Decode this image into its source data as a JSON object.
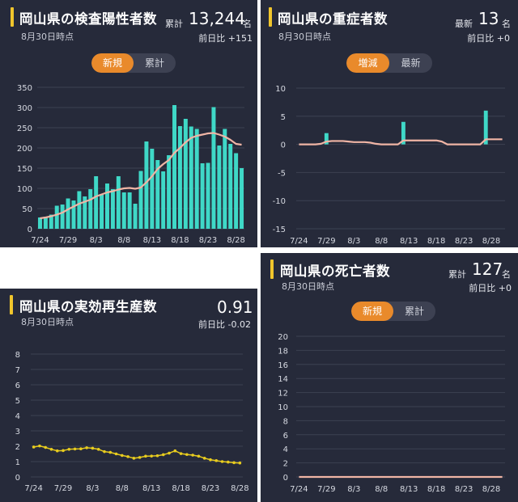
{
  "panels": {
    "positive": {
      "title": "岡山県の検査陽性者数",
      "as_of": "8月30日時点",
      "total_label": "累計",
      "total_value": "13,244",
      "unit": "名",
      "delta": "前日比 +151",
      "toggle": [
        "新規",
        "累計"
      ],
      "active_toggle": 0
    },
    "severe": {
      "title": "岡山県の重症者数",
      "as_of": "8月30日時点",
      "total_label": "最新",
      "total_value": "13",
      "unit": "名",
      "delta": "前日比 +0",
      "toggle": [
        "増減",
        "最新"
      ],
      "active_toggle": 0
    },
    "rt": {
      "title": "岡山県の実効再生産数",
      "as_of": "8月30日時点",
      "total_value": "0.91",
      "delta": "前日比 -0.02"
    },
    "deaths": {
      "title": "岡山県の死亡者数",
      "as_of": "8月30日時点",
      "total_label": "累計",
      "total_value": "127",
      "unit": "名",
      "delta": "前日比 +0",
      "toggle": [
        "新規",
        "累計"
      ],
      "active_toggle": 0
    }
  },
  "colors": {
    "panel_bg": "#262a3a",
    "bar": "#3fd8c7",
    "avg_line": "#f0b5a5",
    "rt_line": "#e8cc1e",
    "accent_title": "#f0c52c",
    "toggle_active": "#e98a2b"
  },
  "chart_data": [
    {
      "id": "positive",
      "type": "bar",
      "x_tick_labels": [
        "7/24",
        "7/29",
        "8/3",
        "8/8",
        "8/13",
        "8/18",
        "8/23",
        "8/28"
      ],
      "x_tick_index": [
        0,
        5,
        10,
        15,
        20,
        25,
        30,
        35
      ],
      "ylim": [
        0,
        350
      ],
      "yticks": [
        0,
        50,
        100,
        150,
        200,
        250,
        300,
        350
      ],
      "grid": true,
      "series": [
        {
          "type": "bar",
          "values": [
            28,
            30,
            35,
            57,
            60,
            75,
            70,
            93,
            80,
            98,
            130,
            84,
            112,
            98,
            130,
            90,
            90,
            62,
            143,
            216,
            198,
            170,
            142,
            182,
            306,
            254,
            272,
            253,
            247,
            162,
            163,
            301,
            206,
            247,
            210,
            187,
            150
          ]
        },
        {
          "type": "line",
          "values": [
            26,
            28,
            31,
            35,
            40,
            48,
            55,
            62,
            67,
            72,
            80,
            85,
            90,
            93,
            97,
            100,
            101,
            99,
            102,
            115,
            130,
            148,
            160,
            170,
            188,
            200,
            214,
            225,
            230,
            233,
            236,
            237,
            233,
            228,
            220,
            210,
            208
          ]
        }
      ]
    },
    {
      "id": "severe",
      "type": "bar",
      "x_tick_labels": [
        "7/24",
        "7/29",
        "8/3",
        "8/8",
        "8/13",
        "8/18",
        "8/23",
        "8/28"
      ],
      "x_tick_index": [
        0,
        5,
        10,
        15,
        20,
        25,
        30,
        35
      ],
      "ylim": [
        -15,
        10
      ],
      "yticks": [
        10,
        5,
        0,
        -5,
        -10,
        -15
      ],
      "grid": true,
      "series": [
        {
          "type": "bar",
          "values": [
            0,
            0,
            0,
            0,
            0,
            2,
            0,
            0,
            0,
            0,
            0,
            0,
            0,
            0,
            0,
            0,
            0,
            0,
            0,
            4,
            0,
            0,
            0,
            0,
            0,
            0,
            0,
            0,
            0,
            0,
            0,
            0,
            0,
            0,
            6,
            0,
            0,
            0
          ]
        },
        {
          "type": "line",
          "values": [
            0,
            0,
            0,
            0,
            0.1,
            0.5,
            0.6,
            0.6,
            0.6,
            0.5,
            0.4,
            0.4,
            0.4,
            0.3,
            0.1,
            0,
            0,
            0,
            0,
            0.7,
            0.7,
            0.7,
            0.7,
            0.7,
            0.7,
            0.7,
            0.5,
            0,
            0,
            0,
            0,
            0,
            0,
            0,
            0.9,
            0.9,
            0.9,
            0.9
          ]
        }
      ]
    },
    {
      "id": "rt",
      "type": "line",
      "x_tick_labels": [
        "7/24",
        "7/29",
        "8/3",
        "8/8",
        "8/13",
        "8/18",
        "8/23",
        "8/28"
      ],
      "x_tick_index": [
        0,
        5,
        10,
        15,
        20,
        25,
        30,
        35
      ],
      "ylim": [
        0,
        8
      ],
      "yticks": [
        0,
        1,
        2,
        3,
        4,
        5,
        6,
        7,
        8
      ],
      "grid": true,
      "series": [
        {
          "type": "line",
          "values": [
            1.95,
            2.02,
            1.92,
            1.8,
            1.7,
            1.72,
            1.8,
            1.82,
            1.83,
            1.9,
            1.87,
            1.8,
            1.65,
            1.6,
            1.5,
            1.4,
            1.32,
            1.22,
            1.27,
            1.35,
            1.36,
            1.38,
            1.45,
            1.55,
            1.7,
            1.52,
            1.46,
            1.42,
            1.35,
            1.22,
            1.12,
            1.06,
            1.0,
            0.97,
            0.93,
            0.91
          ]
        }
      ]
    },
    {
      "id": "deaths",
      "type": "bar",
      "x_tick_labels": [
        "7/24",
        "7/29",
        "8/3",
        "8/8",
        "8/13",
        "8/18",
        "8/23",
        "8/28"
      ],
      "x_tick_index": [
        0,
        5,
        10,
        15,
        20,
        25,
        30,
        35
      ],
      "ylim": [
        0,
        20
      ],
      "yticks": [
        0,
        2,
        4,
        6,
        8,
        10,
        12,
        14,
        16,
        18,
        20
      ],
      "grid": true,
      "series": [
        {
          "type": "bar",
          "values": [
            0,
            0,
            0,
            0,
            0,
            0,
            0,
            0,
            0,
            0,
            0,
            0,
            0,
            0,
            0,
            0,
            0,
            0,
            0,
            0,
            0,
            0,
            0,
            0,
            0,
            0,
            0,
            0,
            0,
            0,
            0,
            0,
            0,
            0,
            0,
            0,
            0,
            0
          ]
        },
        {
          "type": "line",
          "values": [
            0,
            0,
            0,
            0,
            0,
            0,
            0,
            0,
            0,
            0,
            0,
            0,
            0,
            0,
            0,
            0,
            0,
            0,
            0,
            0,
            0,
            0,
            0,
            0,
            0,
            0,
            0,
            0,
            0,
            0,
            0,
            0,
            0,
            0,
            0,
            0,
            0,
            0
          ]
        }
      ]
    }
  ]
}
